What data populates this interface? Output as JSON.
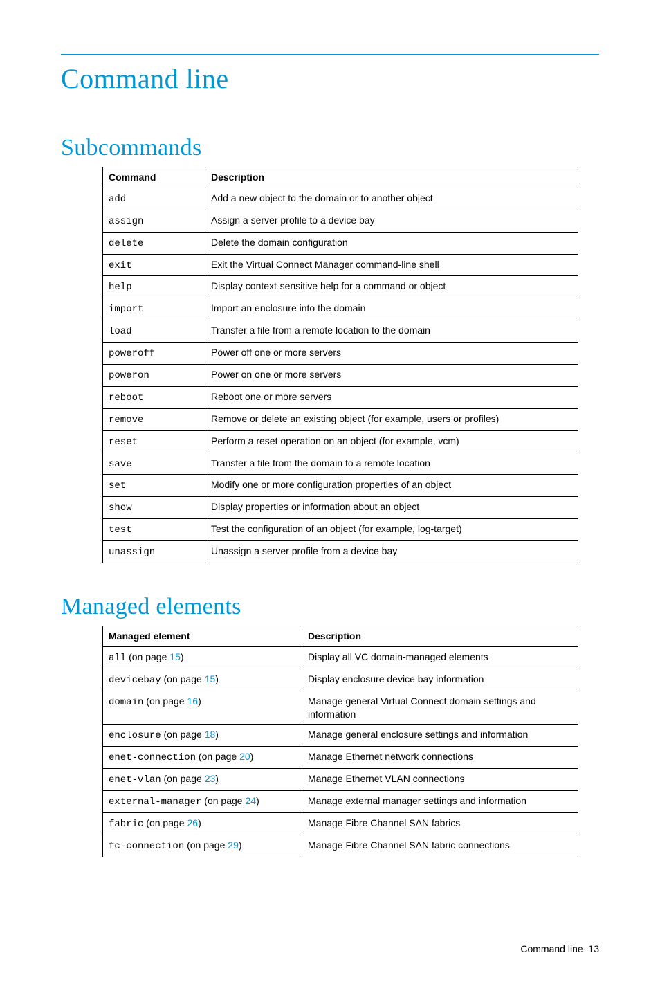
{
  "page_title": "Command line",
  "section1_title": "Subcommands",
  "section2_title": "Managed elements",
  "footer_text": "Command line",
  "footer_page": "13",
  "table1": {
    "headers": {
      "col1": "Command",
      "col2": "Description"
    },
    "rows": [
      {
        "cmd": "add",
        "desc": "Add a new object to the domain or to another object"
      },
      {
        "cmd": "assign",
        "desc": "Assign a server profile to a device bay"
      },
      {
        "cmd": "delete",
        "desc": "Delete the domain configuration"
      },
      {
        "cmd": "exit",
        "desc": "Exit the Virtual Connect Manager command-line shell"
      },
      {
        "cmd": "help",
        "desc": "Display context-sensitive help for a command or object"
      },
      {
        "cmd": "import",
        "desc": "Import an enclosure into the domain"
      },
      {
        "cmd": "load",
        "desc": "Transfer a file from a remote location to the domain"
      },
      {
        "cmd": "poweroff",
        "desc": "Power off one or more servers"
      },
      {
        "cmd": "poweron",
        "desc": "Power on one or more servers"
      },
      {
        "cmd": "reboot",
        "desc": "Reboot one or more servers"
      },
      {
        "cmd": "remove",
        "desc": "Remove or delete an existing object (for example, users or profiles)"
      },
      {
        "cmd": "reset",
        "desc": "Perform a reset operation on an object (for example, vcm)"
      },
      {
        "cmd": "save",
        "desc": "Transfer a file from the domain to a remote location"
      },
      {
        "cmd": "set",
        "desc": "Modify one or more configuration properties of an object"
      },
      {
        "cmd": "show",
        "desc": "Display properties or information about an object"
      },
      {
        "cmd": "test",
        "desc": "Test the configuration of an object (for example, log-target)"
      },
      {
        "cmd": "unassign",
        "desc": "Unassign a server profile from a device bay"
      }
    ]
  },
  "table2": {
    "headers": {
      "col1": "Managed element",
      "col2": "Description"
    },
    "on_page_label": " (on page ",
    "close_paren": ")",
    "rows": [
      {
        "cmd": "all",
        "page": "15",
        "desc": "Display all VC domain-managed elements"
      },
      {
        "cmd": "devicebay",
        "page": "15",
        "desc": "Display enclosure device bay information"
      },
      {
        "cmd": "domain",
        "page": "16",
        "desc": "Manage general Virtual Connect domain settings and information"
      },
      {
        "cmd": "enclosure",
        "page": "18",
        "desc": "Manage general enclosure settings and information"
      },
      {
        "cmd": "enet-connection",
        "page": "20",
        "desc": "Manage Ethernet network connections"
      },
      {
        "cmd": "enet-vlan",
        "page": "23",
        "desc": "Manage Ethernet VLAN connections"
      },
      {
        "cmd": "external-manager",
        "page": "24",
        "desc": "Manage external manager settings and information"
      },
      {
        "cmd": "fabric",
        "page": "26",
        "desc": "Manage Fibre Channel SAN fabrics"
      },
      {
        "cmd": "fc-connection",
        "page": "29",
        "desc": "Manage Fibre Channel SAN fabric connections"
      }
    ]
  }
}
